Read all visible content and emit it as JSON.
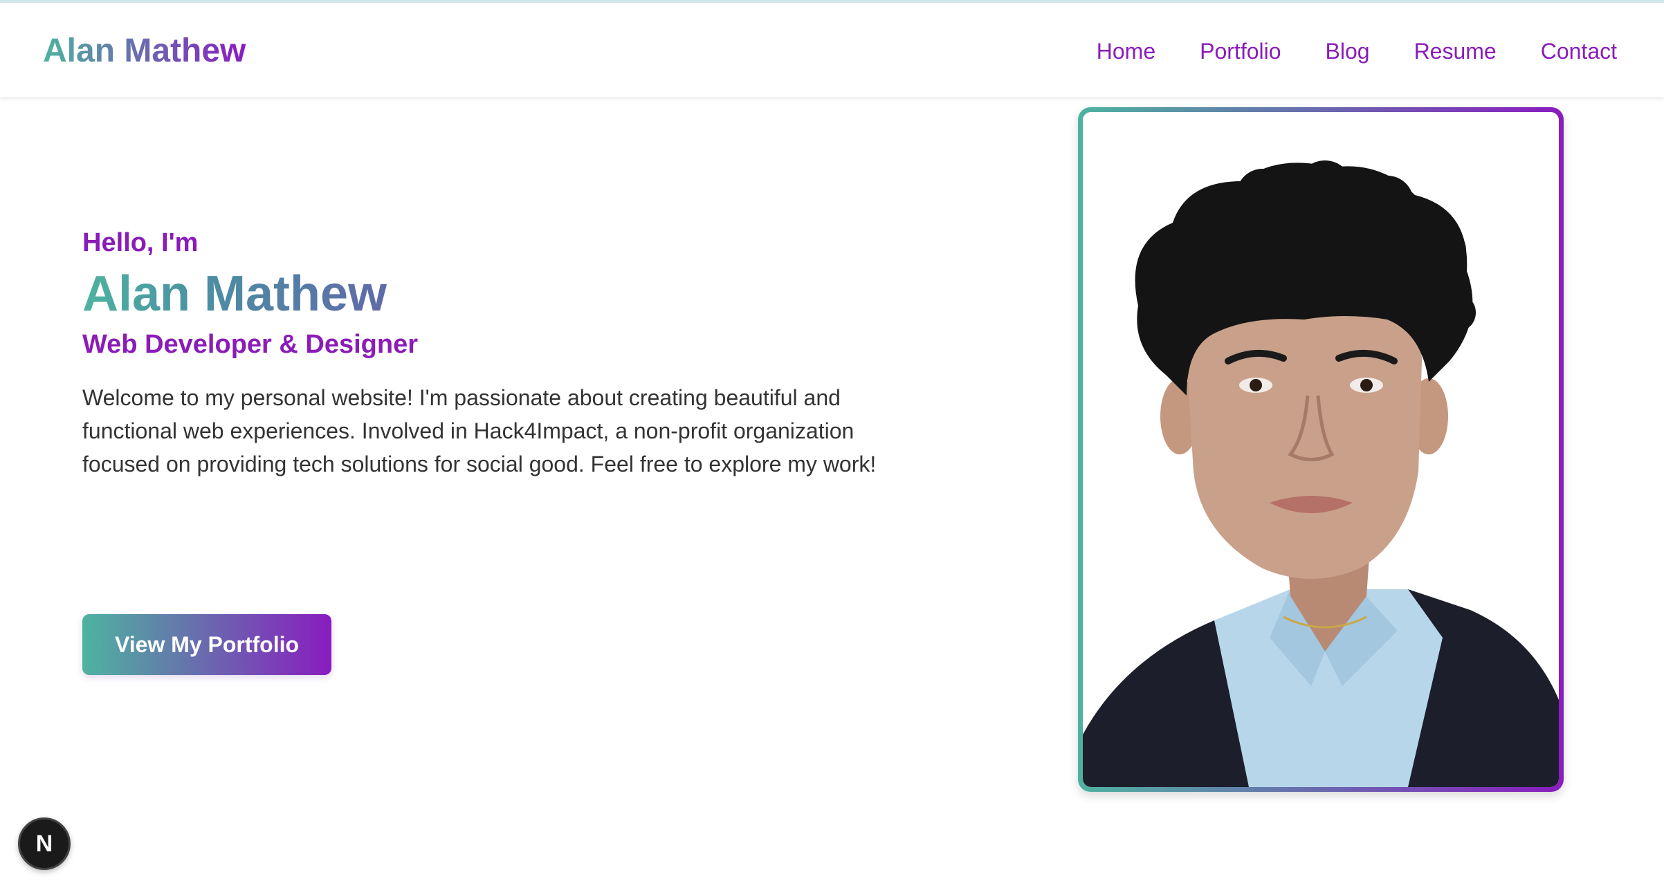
{
  "header": {
    "brand": "Alan Mathew",
    "nav": [
      {
        "label": "Home"
      },
      {
        "label": "Portfolio"
      },
      {
        "label": "Blog"
      },
      {
        "label": "Resume"
      },
      {
        "label": "Contact"
      }
    ]
  },
  "hero": {
    "greeting": "Hello, I'm",
    "name": "Alan Mathew",
    "role": "Web Developer & Designer",
    "intro": "Welcome to my personal website! I'm passionate about creating beautiful and functional web experiences. Involved in Hack4Impact, a non-profit organization focused on providing tech solutions for social good. Feel free to explore my work!",
    "cta_label": "View My Portfolio"
  },
  "badge": {
    "label": "N",
    "icon": "nextjs-icon"
  },
  "colors": {
    "accent_purple": "#8a1cb8",
    "gradient_start": "#4eb3a0",
    "gradient_end": "#8a1cc0",
    "body_text": "#333333"
  }
}
